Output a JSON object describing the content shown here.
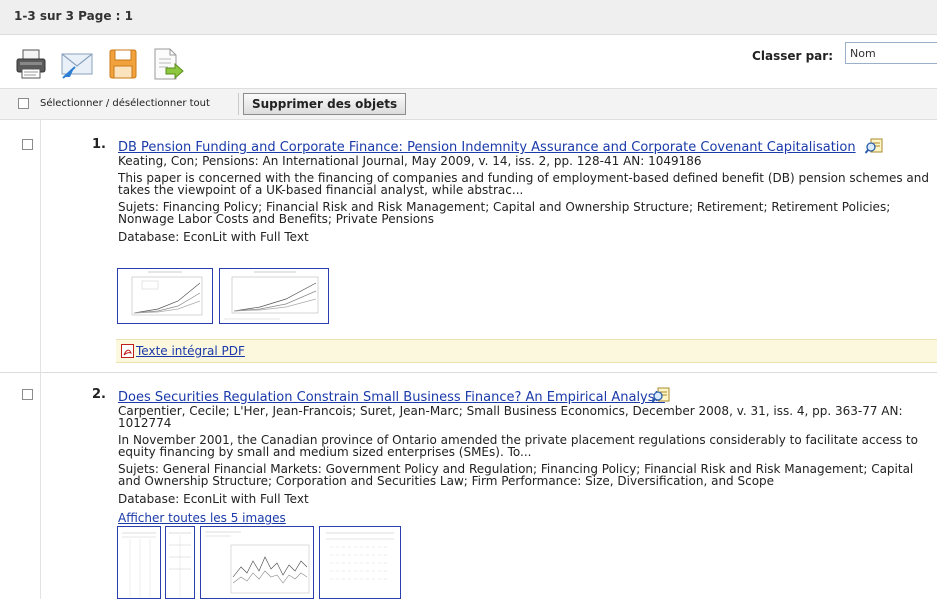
{
  "header": {
    "count": "1-3 sur 3   Page : 1"
  },
  "toolbar": {
    "icons": [
      "print-icon",
      "email-icon",
      "save-icon",
      "export-icon"
    ],
    "sort_label": "Classer par:",
    "sort_value": "Nom"
  },
  "select_bar": {
    "select_all_label": "Sélectionner / désélectionner tout",
    "delete_label": "Supprimer des objets"
  },
  "results": [
    {
      "number": "1.",
      "title": "DB Pension Funding and Corporate Finance: Pension Indemnity Assurance and Corporate Covenant Capitalisation",
      "citation": "Keating, Con; Pensions: An International Journal, May 2009, v. 14, iss. 2, pp. 128-41 AN: 1049186",
      "abstract_1": "This paper is concerned with the financing of companies and funding of employment-based defined benefit (DB) pension schemes and",
      "abstract_2": "takes the viewpoint of a UK-based financial analyst, while abstrac...",
      "subjects_1": "Sujets: Financing Policy; Financial Risk and Risk Management; Capital and Ownership Structure; Retirement; Retirement Policies;",
      "subjects_2": "Nonwage Labor Costs and Benefits; Private Pensions",
      "database": "Database: EconLit with Full Text",
      "pdf_link": "Texte intégral PDF"
    },
    {
      "number": "2.",
      "title": "Does Securities Regulation Constrain Small Business Finance? An Empirical Analysis",
      "citation_1": "Carpentier, Cecile; L'Her, Jean-Francois; Suret, Jean-Marc; Small Business Economics, December 2008, v. 31, iss. 4, pp. 363-77 AN:",
      "citation_2": "1012774",
      "abstract_1": "In November 2001, the Canadian province of Ontario amended the private placement regulations considerably to facilitate access to",
      "abstract_2": "equity financing by small and medium sized enterprises (SMEs). To...",
      "subjects_1": "Sujets: General Financial Markets: Government Policy and Regulation; Financing Policy; Financial Risk and Risk Management; Capital",
      "subjects_2": "and Ownership Structure; Corporation and Securities Law; Firm Performance: Size, Diversification, and Scope",
      "database": "Database: EconLit with Full Text",
      "show_images": "Afficher toutes les 5 images"
    }
  ]
}
